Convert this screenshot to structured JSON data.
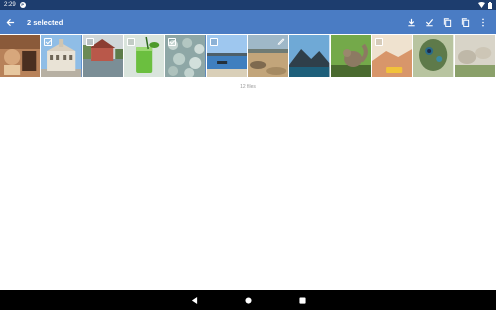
{
  "status_bar": {
    "time": "2:29",
    "notification_badge": "P"
  },
  "toolbar": {
    "title": "2 selected",
    "actions": [
      "download-icon",
      "select-all-icon",
      "copy-icon",
      "copy-alt-icon",
      "more-vert-icon"
    ]
  },
  "gallery": {
    "tiles": [
      {
        "name": "crafts",
        "selected": false,
        "checkbox": "none"
      },
      {
        "name": "town-hall",
        "selected": true,
        "checkbox": "checked"
      },
      {
        "name": "lake-house",
        "selected": false,
        "checkbox": "empty"
      },
      {
        "name": "green-drink",
        "selected": false,
        "checkbox": "empty"
      },
      {
        "name": "succulents",
        "selected": true,
        "checkbox": "checked"
      },
      {
        "name": "lake-boat",
        "selected": false,
        "checkbox": "empty"
      },
      {
        "name": "beach-rocks",
        "selected": false,
        "checkbox": "edit"
      },
      {
        "name": "mountains",
        "selected": false,
        "checkbox": "none"
      },
      {
        "name": "squirrel",
        "selected": false,
        "checkbox": "none"
      },
      {
        "name": "desert-car",
        "selected": false,
        "checkbox": "empty"
      },
      {
        "name": "peacock",
        "selected": false,
        "checkbox": "none"
      },
      {
        "name": "rocks-grass",
        "selected": false,
        "checkbox": "none"
      }
    ],
    "file_count": "12 files"
  },
  "colors": {
    "status_bar": "#1d3d6e",
    "app_bar": "#4a7cc4",
    "nav_bar": "#000000"
  },
  "nav": {
    "back": "back-triangle-icon",
    "home": "home-circle-icon",
    "recents": "recents-square-icon"
  }
}
